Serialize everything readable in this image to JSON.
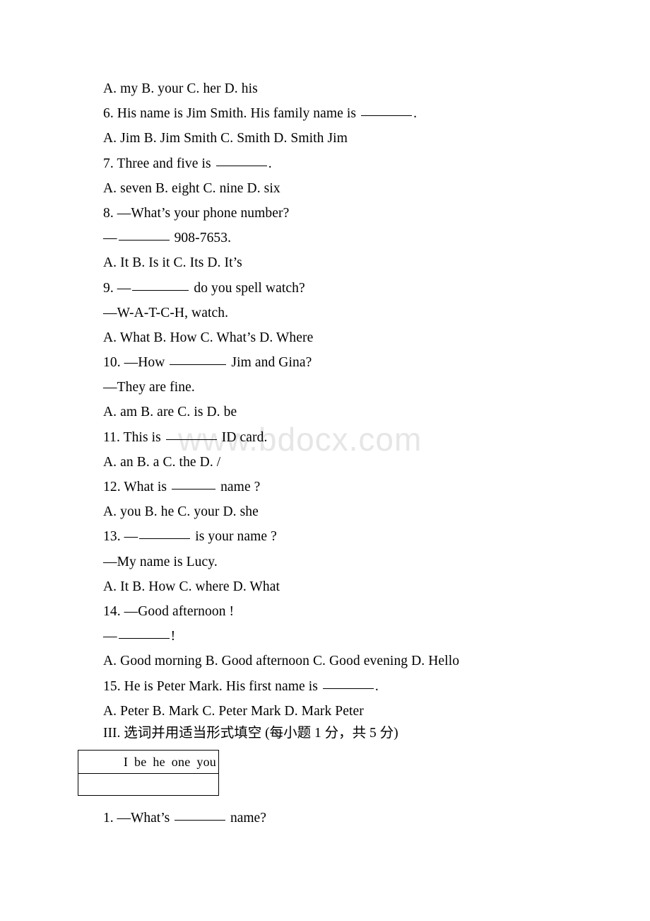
{
  "watermark": {
    "text": "www.bdocx.com",
    "color": "#e6e6e6"
  },
  "document": {
    "lines": [
      {
        "id": "q5-options",
        "text": "A. my    B. your    C. her     D. his"
      },
      {
        "id": "q6-stem",
        "pre": "6. His name is Jim Smith. His family name is ",
        "blank": "md",
        "post": "."
      },
      {
        "id": "q6-options",
        "text": "A. Jim   B. Jim Smith  C. Smith    D. Smith Jim"
      },
      {
        "id": "q7-stem",
        "pre": "7. Three and five is ",
        "blank": "md",
        "post": "."
      },
      {
        "id": "q7-options",
        "text": "A. seven    B. eight   C. nine    D. six"
      },
      {
        "id": "q8-stem",
        "text": "8. —What’s your phone number?"
      },
      {
        "id": "q8-answer",
        "pre": "—",
        "blank": "md",
        "post": " 908-7653."
      },
      {
        "id": "q8-options",
        "text": "A. It     B. Is it     C. Its     D. It’s"
      },
      {
        "id": "q9-stem",
        "pre": "9. —",
        "blank": "lg",
        "post": " do you spell watch?"
      },
      {
        "id": "q9-answer",
        "text": "—W-A-T-C-H, watch."
      },
      {
        "id": "q9-options",
        "text": "A. What    B. How    C. What’s    D. Where"
      },
      {
        "id": "q10-stem",
        "pre": "10. —How ",
        "blank": "lg",
        "post": " Jim and Gina?"
      },
      {
        "id": "q10-answer",
        "text": "—They are fine."
      },
      {
        "id": "q10-options",
        "text": "A. am     B. are     C. is     D. be"
      },
      {
        "id": "q11-stem",
        "pre": "11. This is ",
        "blank": "md",
        "post": " ID card."
      },
      {
        "id": "q11-options",
        "text": "A. an    B. a     C. the     D. /"
      },
      {
        "id": "q12-stem",
        "pre": "12. What is ",
        "blank": "sm",
        "post": " name ?"
      },
      {
        "id": "q12-options",
        "text": "A. you    B. he    C. your   D. she"
      },
      {
        "id": "q13-stem",
        "pre": "13. —",
        "blank": "md",
        "post": " is your name ?"
      },
      {
        "id": "q13-answer",
        "text": "—My name is Lucy."
      },
      {
        "id": "q13-options",
        "text": "A. It    B. How    C. where    D. What"
      },
      {
        "id": "q14-stem",
        "text": "14. —Good afternoon !"
      },
      {
        "id": "q14-answer",
        "pre": "—",
        "blank": "md",
        "post": "!"
      },
      {
        "id": "q14-options",
        "text": "A. Good morning  B. Good afternoon  C. Good evening  D. Hello"
      },
      {
        "id": "q15-stem",
        "pre": "15. He is Peter Mark. His first name is ",
        "blank": "md",
        "post": "."
      },
      {
        "id": "q15-options",
        "text": "A. Peter    B. Mark    C. Peter Mark   D. Mark Peter"
      }
    ],
    "section_heading": "III. 选词并用适当形式填空 (每小题 1 分，共 5 分)",
    "word_bank": {
      "words": [
        "I",
        "be",
        "he",
        "one",
        "you"
      ],
      "empty_row": ""
    },
    "tail": {
      "pre": "1. —What’s ",
      "blank": "md",
      "post": " name?"
    }
  }
}
